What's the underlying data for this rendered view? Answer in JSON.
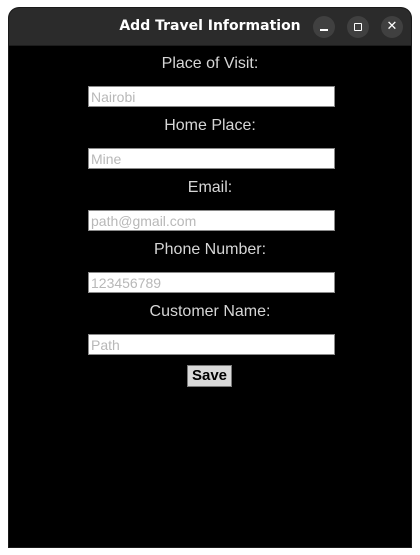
{
  "window": {
    "title": "Add Travel Information",
    "controls": {
      "minimize": "minimize-icon",
      "maximize": "maximize-icon",
      "close": "close-icon"
    }
  },
  "form": {
    "fields": [
      {
        "label": "Place of Visit:",
        "placeholder": "Nairobi",
        "value": ""
      },
      {
        "label": "Home Place:",
        "placeholder": "Mine",
        "value": ""
      },
      {
        "label": "Email:",
        "placeholder": "path@gmail.com",
        "value": ""
      },
      {
        "label": "Phone Number:",
        "placeholder": "123456789",
        "value": ""
      },
      {
        "label": "Customer Name:",
        "placeholder": "Path",
        "value": ""
      }
    ],
    "save_label": "Save"
  },
  "colors": {
    "window_background": "#000000",
    "titlebar_background": "#2b2b2b",
    "label_text": "#d6d6d6",
    "input_background": "#ffffff",
    "placeholder_text": "#b8b8b8",
    "button_background": "#d9d9d9"
  }
}
